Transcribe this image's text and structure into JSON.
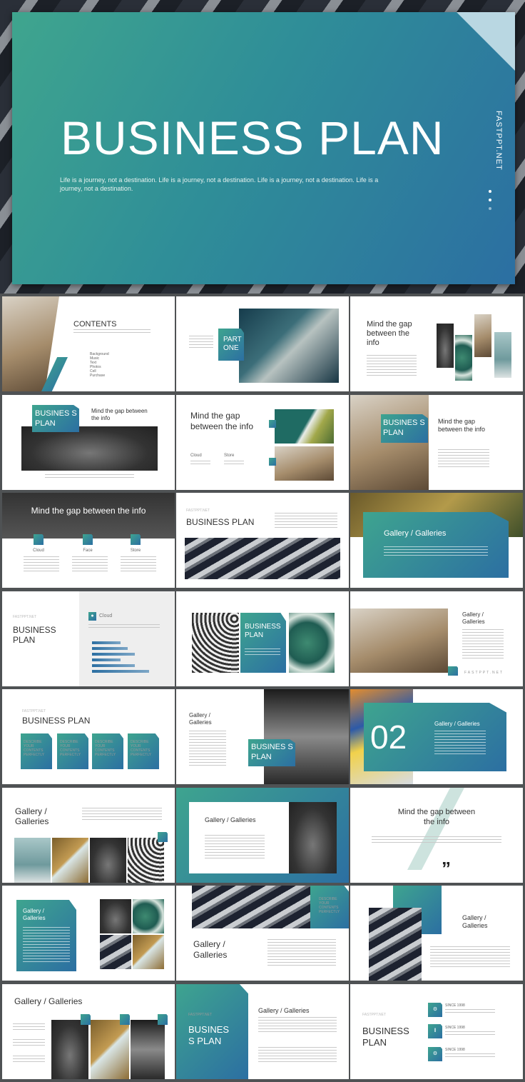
{
  "hero": {
    "title": "BUSINESS PLAN",
    "subtitle": "Life is a journey, not a destination. Life is a journey, not a destination. Life is a journey, not a destination. Life is a journey, not a destination.",
    "brand": "FASTPPT.NET"
  },
  "colors": {
    "accent_start": "#3ea48f",
    "accent_end": "#2c6fa2",
    "background": "#4f5254",
    "fold": "#b9d7e2"
  },
  "slides": {
    "s1": {
      "title": "CONTENTS",
      "items": [
        "Background",
        "Music",
        "Text",
        "Photos",
        "Cell",
        "Purchase"
      ]
    },
    "s2": {
      "title": "PART ONE"
    },
    "s3": {
      "title": "Mind the gap between the info"
    },
    "s4": {
      "badge": "BUSINES S PLAN",
      "title": "Mind the gap between the info"
    },
    "s5": {
      "title": "Mind the gap between the info",
      "col1": "Cloud",
      "col2": "Store"
    },
    "s6": {
      "badge": "BUSINES S PLAN",
      "title": "Mind the gap between the info"
    },
    "s7": {
      "title": "Mind the gap between the info",
      "cols": [
        "Cloud",
        "Face",
        "Store"
      ]
    },
    "s8": {
      "brand": "FASTPPT.NET",
      "title": "BUSINESS PLAN"
    },
    "s9": {
      "title": "Gallery / Galleries"
    },
    "s10": {
      "brand": "FASTPPT.NET",
      "title": "BUSINESS PLAN",
      "label": "Cloud",
      "bars": [
        0.4,
        0.5,
        0.6,
        0.4,
        0.6,
        0.8
      ]
    },
    "s11": {
      "title": "BUSINESS PLAN"
    },
    "s12": {
      "title": "Gallery / Galleries",
      "brand": "FASTPPT.NET"
    },
    "s13": {
      "brand": "FASTPPT.NET",
      "title": "BUSINESS PLAN",
      "cards": [
        "DESCRIBE YOUR CONTENTS PERFECTLY",
        "DESCRIBE YOUR CONTENTS PERFECTLY",
        "DESCRIBE YOUR CONTENTS PERFECTLY",
        "DESCRIBE YOUR CONTENTS PERFECTLY"
      ]
    },
    "s14": {
      "title": "Gallery / Galleries",
      "badge": "BUSINES S PLAN"
    },
    "s15": {
      "number": "02",
      "title": "Gallery / Galleries"
    },
    "s16": {
      "title": "Gallery / Galleries"
    },
    "s17": {
      "title": "Gallery / Galleries"
    },
    "s18": {
      "title": "Mind the gap between the info",
      "quote": "”"
    },
    "s19": {
      "title": "Gallery / Galleries"
    },
    "s20": {
      "badge": "DESCRIBE YOUR CONTENTS PERFECTLY",
      "title": "Gallery / Galleries"
    },
    "s21": {
      "title": "Gallery / Galleries"
    },
    "s22": {
      "title": "Gallery / Galleries"
    },
    "s23": {
      "brand": "FASTPPT.NET",
      "badge": "BUSINES S PLAN",
      "title": "Gallery / Galleries"
    },
    "s24": {
      "brand": "FASTPPT.NET",
      "title": "BUSINESS PLAN",
      "items": [
        "SINCE 1998",
        "SINCE 1998",
        "SINCE 1998"
      ]
    }
  }
}
